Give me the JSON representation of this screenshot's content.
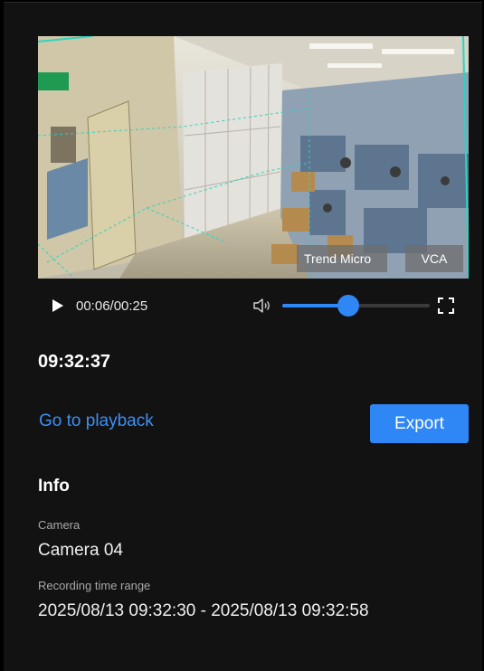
{
  "video": {
    "overlay_tags": [
      "Trend Micro",
      "VCA"
    ]
  },
  "controls": {
    "time": "00:06/00:25",
    "volume_level": 0.45,
    "icons": {
      "play": "play-icon",
      "volume": "volume-icon",
      "fullscreen": "fullscreen-icon"
    }
  },
  "clock": "09:32:37",
  "actions": {
    "playback_link": "Go to playback",
    "export_label": "Export"
  },
  "info": {
    "title": "Info",
    "camera_label": "Camera",
    "camera_value": "Camera 04",
    "range_label": "Recording time range",
    "range_value": "2025/08/13 09:32:30 - 2025/08/13 09:32:58"
  },
  "colors": {
    "accent": "#2f86f5",
    "link": "#3d8ff5",
    "background": "#121212"
  }
}
